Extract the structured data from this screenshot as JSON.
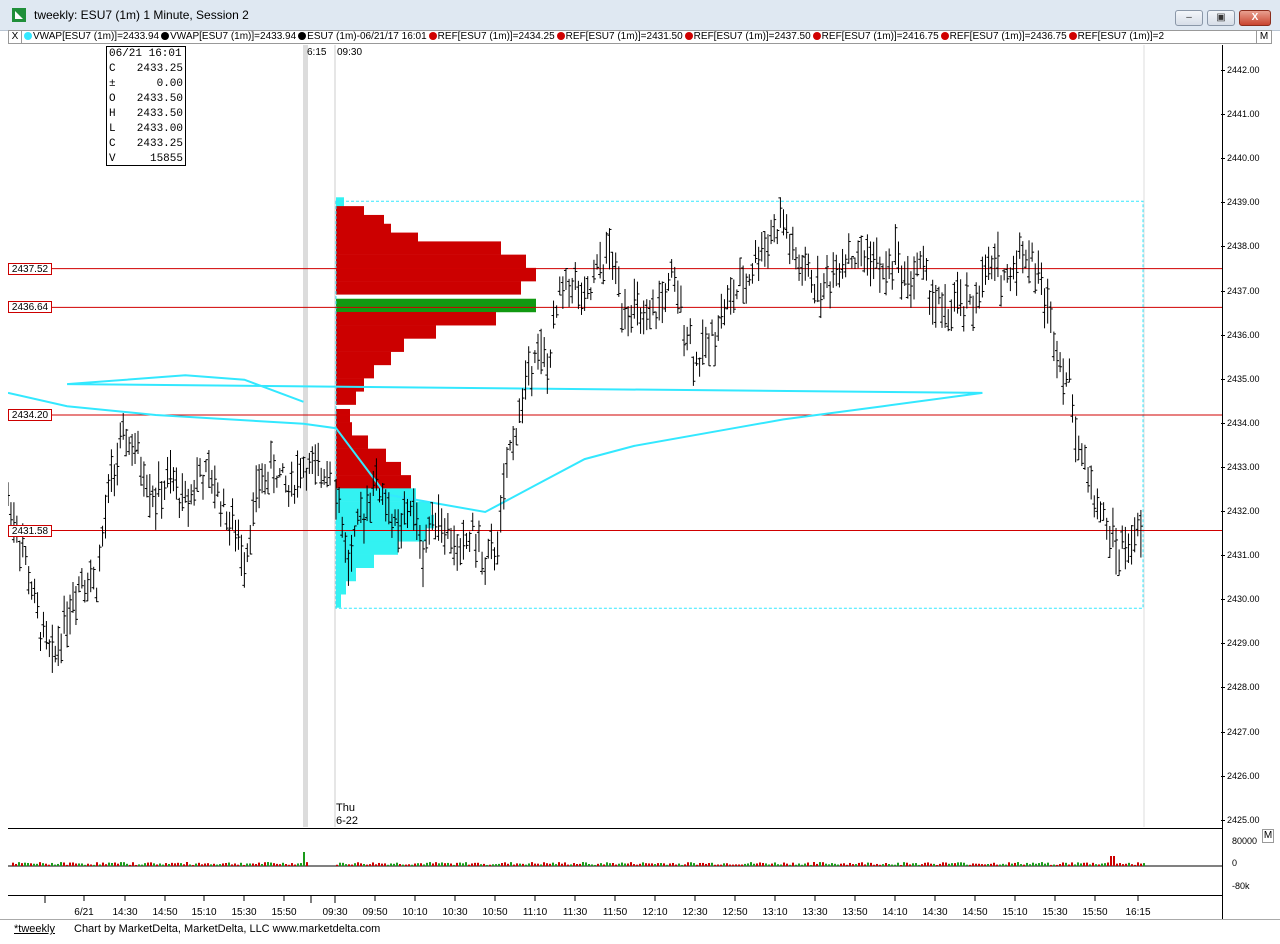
{
  "window": {
    "title": "tweekly: ESU7 (1m) 1 Minute, Session 2",
    "minimize": "–",
    "restore": "▣",
    "close": "X"
  },
  "legend": {
    "close_x": "X",
    "m_button": "M",
    "items": [
      {
        "text": "VWAP[ESU7 (1m)]=2433.94",
        "color": "#33e8ff"
      },
      {
        "text": "VWAP[ESU7 (1m)]=2433.94",
        "color": "#000000"
      },
      {
        "text": "ESU7 (1m)-06/21/17 16:01",
        "color": "#000000"
      },
      {
        "text": "REF[ESU7 (1m)]=2434.25",
        "color": "#d00000"
      },
      {
        "text": "REF[ESU7 (1m)]=2431.50",
        "color": "#d00000"
      },
      {
        "text": "REF[ESU7 (1m)]=2437.50",
        "color": "#d00000"
      },
      {
        "text": "REF[ESU7 (1m)]=2416.75",
        "color": "#d00000"
      },
      {
        "text": "REF[ESU7 (1m)]=2436.75",
        "color": "#d00000"
      },
      {
        "text": "REF[ESU7 (1m)]=2",
        "color": "#d00000"
      }
    ]
  },
  "ohlc_box": {
    "date": "06/21 16:01",
    "rows": [
      {
        "k": "C",
        "v": "2433.25"
      },
      {
        "k": "±",
        "v": "0.00"
      },
      {
        "k": "O",
        "v": "2433.50"
      },
      {
        "k": "H",
        "v": "2433.50"
      },
      {
        "k": "L",
        "v": "2433.00"
      },
      {
        "k": "C",
        "v": "2433.25"
      },
      {
        "k": "V",
        "v": "15855"
      }
    ]
  },
  "session_labels": {
    "start": "6:15",
    "open": "09:30",
    "day": "Thu",
    "date": "6-22"
  },
  "ref_levels": [
    {
      "label": "2437.52",
      "price": 2437.52
    },
    {
      "label": "2436.64",
      "price": 2436.64
    },
    {
      "label": "2434.20",
      "price": 2434.2
    },
    {
      "label": "2431.58",
      "price": 2431.58
    }
  ],
  "price_axis": [
    "2442.00",
    "2441.00",
    "2440.00",
    "2439.00",
    "2438.00",
    "2437.00",
    "2436.00",
    "2435.00",
    "2434.00",
    "2433.00",
    "2432.00",
    "2431.00",
    "2430.00",
    "2429.00",
    "2428.00",
    "2427.00",
    "2426.00",
    "2425.00"
  ],
  "volume_axis": [
    "80000",
    "0",
    "-80k"
  ],
  "volume_m": "M",
  "time_axis": [
    "6/21",
    "14:30",
    "14:50",
    "15:10",
    "15:30",
    "15:50",
    "09:30",
    "09:50",
    "10:10",
    "10:30",
    "10:50",
    "11:10",
    "11:30",
    "11:50",
    "12:10",
    "12:30",
    "12:50",
    "13:10",
    "13:30",
    "13:50",
    "14:10",
    "14:30",
    "14:50",
    "15:10",
    "15:30",
    "15:50",
    "16:15"
  ],
  "status": {
    "tab": "*tweekly",
    "info": "Chart by MarketDelta, MarketDelta, LLC www.marketdelta.com"
  },
  "colors": {
    "vwap": "#33e8ff",
    "ref_line": "#d00000",
    "profile_red": "#cc0000",
    "profile_green": "#119911",
    "profile_cyan": "#33f2f2"
  },
  "chart_data": {
    "type": "candlestick-bars",
    "symbol": "ESU7 (1m)",
    "ylim": [
      2425,
      2442.5
    ],
    "price_series": [
      {
        "t": "6/21 14:15",
        "p": 2432.3
      },
      {
        "t": "14:20",
        "p": 2431.2
      },
      {
        "t": "6/21",
        "p": 2429.6
      },
      {
        "t": "14:25",
        "p": 2428.6
      },
      {
        "t": "14:30",
        "p": 2429.7
      },
      {
        "t": "14:35",
        "p": 2430.6
      },
      {
        "t": "14:40",
        "p": 2430.4
      },
      {
        "t": "14:45",
        "p": 2432.8
      },
      {
        "t": "14:50",
        "p": 2433.7
      },
      {
        "t": "14:55",
        "p": 2433.1
      },
      {
        "t": "15:00",
        "p": 2432.3
      },
      {
        "t": "15:05",
        "p": 2432.7
      },
      {
        "t": "15:10",
        "p": 2432.2
      },
      {
        "t": "15:15",
        "p": 2432.9
      },
      {
        "t": "15:20",
        "p": 2432.6
      },
      {
        "t": "15:25",
        "p": 2431.8
      },
      {
        "t": "15:30",
        "p": 2431.0
      },
      {
        "t": "15:35",
        "p": 2432.6
      },
      {
        "t": "15:40",
        "p": 2433.0
      },
      {
        "t": "15:45",
        "p": 2432.5
      },
      {
        "t": "15:50",
        "p": 2433.1
      },
      {
        "t": "15:55",
        "p": 2432.8
      },
      {
        "t": "16:00",
        "p": 2433.3
      },
      {
        "t": "09:30",
        "p": 2432.6
      },
      {
        "t": "09:35",
        "p": 2430.8
      },
      {
        "t": "09:40",
        "p": 2431.8
      },
      {
        "t": "09:45",
        "p": 2432.7
      },
      {
        "t": "09:50",
        "p": 2432.3
      },
      {
        "t": "09:55",
        "p": 2431.4
      },
      {
        "t": "10:00",
        "p": 2432.2
      },
      {
        "t": "10:05",
        "p": 2431.1
      },
      {
        "t": "10:10",
        "p": 2432.1
      },
      {
        "t": "10:15",
        "p": 2431.5
      },
      {
        "t": "10:20",
        "p": 2431.0
      },
      {
        "t": "10:25",
        "p": 2431.6
      },
      {
        "t": "10:30",
        "p": 2430.7
      },
      {
        "t": "10:35",
        "p": 2431.3
      },
      {
        "t": "10:40",
        "p": 2433.4
      },
      {
        "t": "10:45",
        "p": 2434.5
      },
      {
        "t": "10:50",
        "p": 2435.8
      },
      {
        "t": "10:55",
        "p": 2435.2
      },
      {
        "t": "11:00",
        "p": 2436.9
      },
      {
        "t": "11:05",
        "p": 2437.3
      },
      {
        "t": "11:10",
        "p": 2436.6
      },
      {
        "t": "11:15",
        "p": 2437.4
      },
      {
        "t": "11:20",
        "p": 2437.9
      },
      {
        "t": "11:25",
        "p": 2436.8
      },
      {
        "t": "11:30",
        "p": 2436.6
      },
      {
        "t": "11:35",
        "p": 2436.1
      },
      {
        "t": "11:40",
        "p": 2436.7
      },
      {
        "t": "11:45",
        "p": 2437.2
      },
      {
        "t": "11:50",
        "p": 2436.4
      },
      {
        "t": "11:55",
        "p": 2435.4
      },
      {
        "t": "12:00",
        "p": 2435.8
      },
      {
        "t": "12:05",
        "p": 2436.5
      },
      {
        "t": "12:10",
        "p": 2436.9
      },
      {
        "t": "12:15",
        "p": 2437.2
      },
      {
        "t": "12:20",
        "p": 2437.9
      },
      {
        "t": "12:25",
        "p": 2438.3
      },
      {
        "t": "12:30",
        "p": 2438.6
      },
      {
        "t": "12:35",
        "p": 2437.6
      },
      {
        "t": "12:40",
        "p": 2437.4
      },
      {
        "t": "12:45",
        "p": 2437.0
      },
      {
        "t": "12:50",
        "p": 2437.4
      },
      {
        "t": "12:55",
        "p": 2437.9
      },
      {
        "t": "13:00",
        "p": 2437.7
      },
      {
        "t": "13:05",
        "p": 2437.9
      },
      {
        "t": "13:10",
        "p": 2437.3
      },
      {
        "t": "13:15",
        "p": 2437.8
      },
      {
        "t": "13:20",
        "p": 2437.2
      },
      {
        "t": "13:25",
        "p": 2437.6
      },
      {
        "t": "13:30",
        "p": 2436.9
      },
      {
        "t": "13:35",
        "p": 2436.4
      },
      {
        "t": "13:40",
        "p": 2436.7
      },
      {
        "t": "13:45",
        "p": 2436.6
      },
      {
        "t": "13:50",
        "p": 2437.2
      },
      {
        "t": "13:55",
        "p": 2437.6
      },
      {
        "t": "14:00",
        "p": 2437.3
      },
      {
        "t": "14:05",
        "p": 2437.9
      },
      {
        "t": "14:10",
        "p": 2437.8
      },
      {
        "t": "14:15",
        "p": 2436.9
      },
      {
        "t": "14:20",
        "p": 2435.8
      },
      {
        "t": "14:25",
        "p": 2434.8
      },
      {
        "t": "14:30",
        "p": 2433.2
      },
      {
        "t": "14:35",
        "p": 2432.4
      },
      {
        "t": "14:40",
        "p": 2431.6
      },
      {
        "t": "14:45",
        "p": 2431.1
      },
      {
        "t": "14:50",
        "p": 2431.3
      },
      {
        "t": "14:55",
        "p": 2431.6
      }
    ],
    "vwap_series": [
      {
        "t": "6/21 14:15",
        "p": 2434.7
      },
      {
        "t": "14:30",
        "p": 2434.4
      },
      {
        "t": "15:00",
        "p": 2434.2
      },
      {
        "t": "15:50",
        "p": 2434.0
      },
      {
        "t": "09:30",
        "p": 2433.9
      },
      {
        "t": "09:50",
        "p": 2432.4
      },
      {
        "t": "10:30",
        "p": 2432.0
      },
      {
        "t": "10:50",
        "p": 2432.6
      },
      {
        "t": "11:10",
        "p": 2433.2
      },
      {
        "t": "11:30",
        "p": 2433.5
      },
      {
        "t": "12:10",
        "p": 2433.9
      },
      {
        "t": "12:30",
        "p": 2434.1
      },
      {
        "t": "13:10",
        "p": 2434.4
      },
      {
        "t": "13:50",
        "p": 2434.7
      },
      {
        "t": "14:30",
        "p": 2434.9
      },
      {
        "t": "14:50",
        "p": 2435.0
      },
      {
        "t": "15:10",
        "p": 2435.1
      },
      {
        "t": "15:30",
        "p": 2435.0
      },
      {
        "t": "15:50",
        "p": 2434.5
      }
    ],
    "volume_profile": {
      "price_range": [
        2430.0,
        2439.0
      ],
      "poc_price": 2436.7,
      "value_area_low": 2432.6,
      "value_area_high": 2437.8
    }
  }
}
